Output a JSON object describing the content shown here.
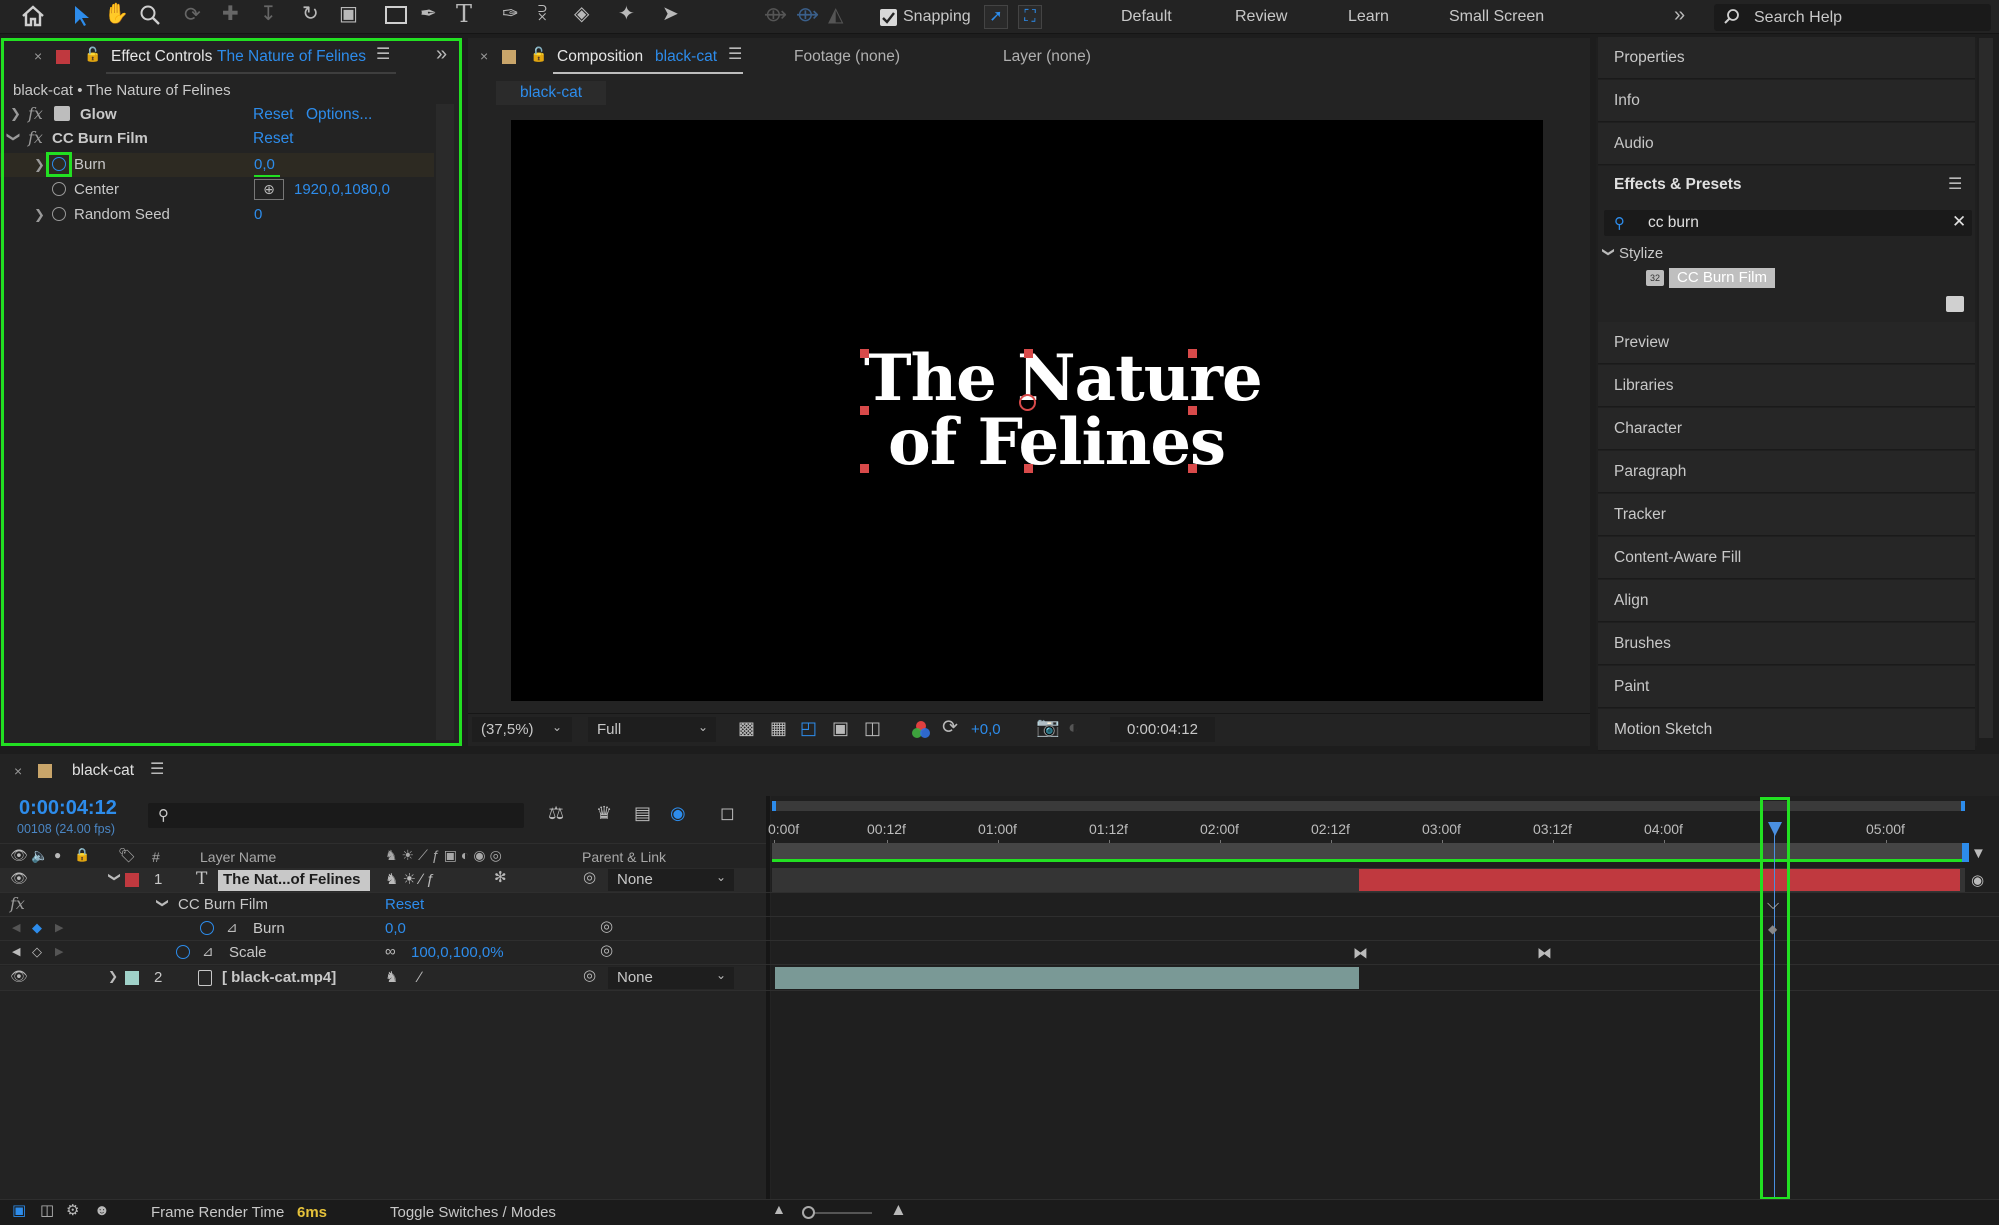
{
  "toolbar": {
    "snapping_label": "Snapping",
    "workspaces": [
      "Default",
      "Review",
      "Learn",
      "Small Screen"
    ],
    "search_placeholder": "Search Help"
  },
  "effect_controls": {
    "tab_label": "Effect Controls",
    "tab_layer": "The Nature of Felines",
    "breadcrumb": "black-cat • The Nature of Felines",
    "effects": [
      {
        "name": "Glow",
        "reset": "Reset",
        "options": "Options..."
      },
      {
        "name": "CC Burn Film",
        "reset": "Reset"
      }
    ],
    "props": [
      {
        "name": "Burn",
        "value": "0,0"
      },
      {
        "name": "Center",
        "value": "1920,0,1080,0"
      },
      {
        "name": "Random Seed",
        "value": "0"
      }
    ]
  },
  "composition": {
    "tab_label": "Composition",
    "tab_name": "black-cat",
    "footage_tab": "Footage (none)",
    "layer_tab": "Layer (none)",
    "subtab": "black-cat",
    "title_line1": "The Nature",
    "title_line2": "of Felines",
    "zoom": "(37,5%)",
    "resolution": "Full",
    "exposure": "+0,0",
    "timecode": "0:00:04:12"
  },
  "right_panel": {
    "items_top": [
      "Properties",
      "Info",
      "Audio"
    ],
    "effects_presets_title": "Effects & Presets",
    "search_value": "cc burn",
    "category": "Stylize",
    "result": "CC Burn Film",
    "items_bottom": [
      "Preview",
      "Libraries",
      "Character",
      "Paragraph",
      "Tracker",
      "Content-Aware Fill",
      "Align",
      "Brushes",
      "Paint",
      "Motion Sketch"
    ]
  },
  "timeline": {
    "comp_name": "black-cat",
    "timecode": "0:00:04:12",
    "frame_info": "00108 (24.00 fps)",
    "col_hash": "#",
    "col_layer_name": "Layer Name",
    "col_parent": "Parent & Link",
    "ruler": [
      "0:00f",
      "00:12f",
      "01:00f",
      "01:12f",
      "02:00f",
      "02:12f",
      "03:00f",
      "03:12f",
      "04:00f",
      "05:00f"
    ],
    "layers": [
      {
        "num": "1",
        "name": "The Nat...of Felines",
        "parent": "None"
      },
      {
        "num": "2",
        "name": "[ black-cat.mp4]",
        "parent": "None"
      }
    ],
    "effect_name": "CC Burn Film",
    "effect_reset": "Reset",
    "burn_label": "Burn",
    "burn_value": "0,0",
    "scale_label": "Scale",
    "scale_value": "100,0,100,0%",
    "fx_label": "fx"
  },
  "status_bar": {
    "render_label": "Frame Render Time",
    "render_value": "6ms",
    "toggle_label": "Toggle Switches / Modes"
  },
  "colors": {
    "accent_blue": "#2d8ceb",
    "highlight_green": "#22e022",
    "layer_red": "#c0393f",
    "layer_teal": "#7a9996"
  }
}
